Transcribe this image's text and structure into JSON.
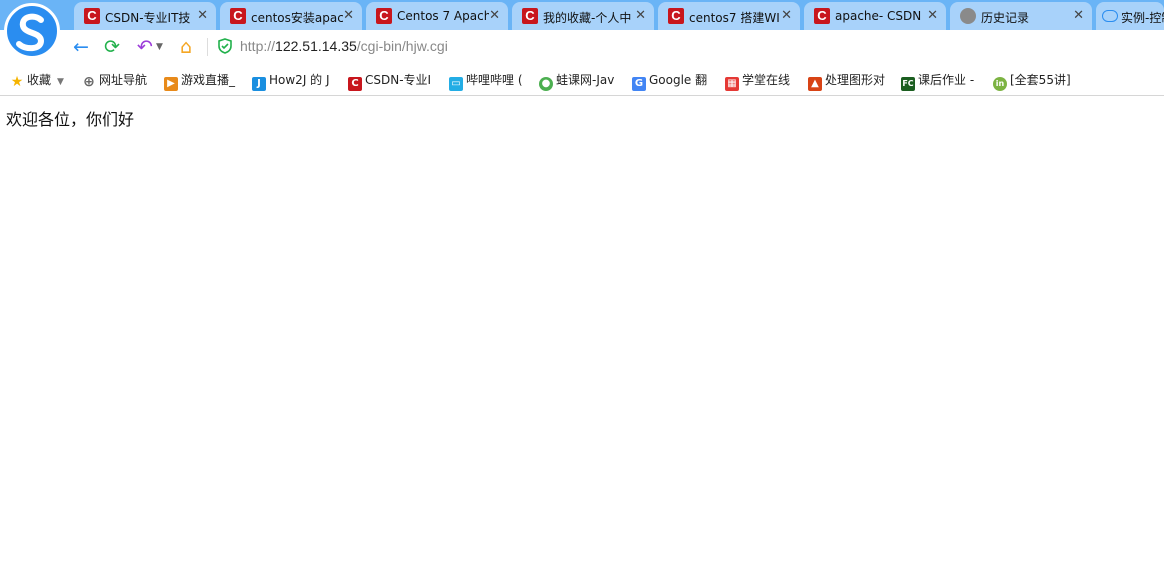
{
  "tabs": [
    {
      "title": "CSDN-专业IT技",
      "icon": "csdn-icon"
    },
    {
      "title": "centos安装apac",
      "icon": "csdn-icon"
    },
    {
      "title": "Centos 7 Apach",
      "icon": "csdn-icon"
    },
    {
      "title": "我的收藏-个人中",
      "icon": "csdn-icon"
    },
    {
      "title": "centos7 搭建WI",
      "icon": "csdn-icon"
    },
    {
      "title": "apache- CSDN",
      "icon": "csdn-icon"
    },
    {
      "title": "历史记录",
      "icon": "clock-icon"
    },
    {
      "title": "实例-控制",
      "icon": "cloud-icon"
    }
  ],
  "tab_close": "✕",
  "address": {
    "scheme": "http://",
    "host": "122.51.14.35",
    "path": "/cgi-bin/hjw.cgi"
  },
  "bookmarks": [
    {
      "label": "收藏",
      "icon": "star-icon",
      "color": "#f5b400"
    },
    {
      "label": "网址导航",
      "icon": "globe-icon",
      "color": "#666666"
    },
    {
      "label": "游戏直播_",
      "icon": "game-icon",
      "color": "#e88a1a"
    },
    {
      "label": "How2J 的 J",
      "icon": "how2j-icon",
      "color": "#1a8fe0"
    },
    {
      "label": "CSDN-专业I",
      "icon": "csdn-icon",
      "color": "#c8161d"
    },
    {
      "label": "哔哩哔哩 (",
      "icon": "bilibili-icon",
      "color": "#23ade5"
    },
    {
      "label": "蛙课网-Jav",
      "icon": "frog-icon",
      "color": "#4caf50"
    },
    {
      "label": "Google 翻",
      "icon": "translate-icon",
      "color": "#4285f4"
    },
    {
      "label": "学堂在线",
      "icon": "xuetang-icon",
      "color": "#e53935"
    },
    {
      "label": "处理图形对",
      "icon": "matlab-icon",
      "color": "#d84315"
    },
    {
      "label": "课后作业 -",
      "icon": "fc-icon",
      "color": "#1b5e20"
    },
    {
      "label": "[全套55讲]",
      "icon": "in-icon",
      "color": "#7cb342"
    }
  ],
  "page": {
    "text": "欢迎各位，你们好"
  },
  "colors": {
    "tabstrip": "#6ab4f6",
    "tab": "#a8d2fa",
    "accent": "#2a8df0"
  }
}
